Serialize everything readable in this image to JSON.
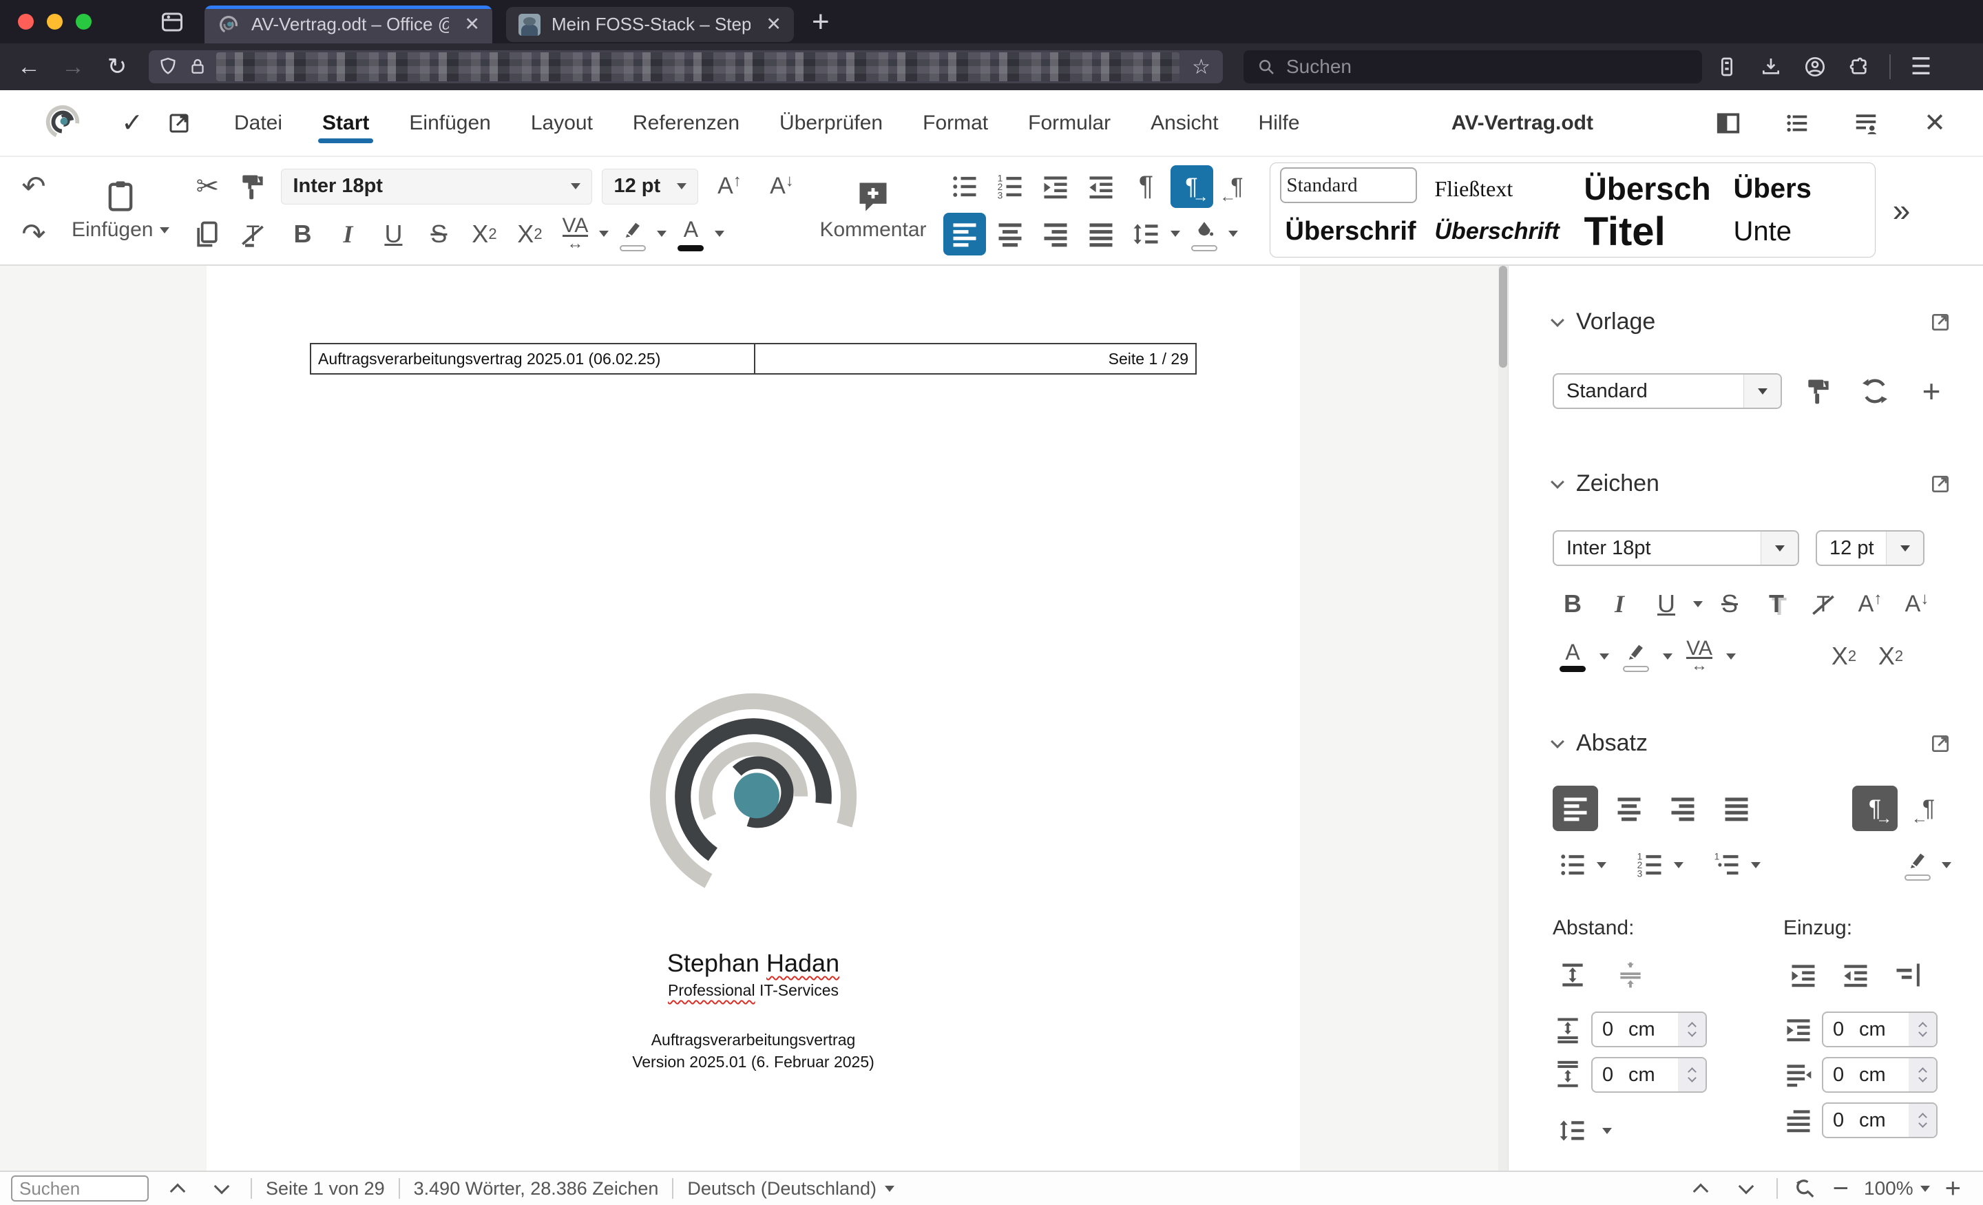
{
  "browser": {
    "tabs": [
      {
        "title": "AV-Vertrag.odt – Office @ Hada",
        "active": true
      },
      {
        "title": "Mein FOSS-Stack – Stephan Ha",
        "active": false
      }
    ],
    "search_placeholder": "Suchen"
  },
  "app": {
    "menu": [
      "Datei",
      "Start",
      "Einfügen",
      "Layout",
      "Referenzen",
      "Überprüfen",
      "Format",
      "Formular",
      "Ansicht",
      "Hilfe"
    ],
    "active_menu": "Start",
    "doc_title": "AV-Vertrag.odt"
  },
  "toolbar": {
    "paste_label": "Einfügen",
    "comment_label": "Kommentar",
    "font_name": "Inter 18pt",
    "font_size": "12 pt",
    "styles": [
      "Standard",
      "Fließtext",
      "Übersch",
      "Übers",
      "Überschrif",
      "Überschrift",
      "Titel",
      "Unte"
    ]
  },
  "sidebar": {
    "vorlage": {
      "title": "Vorlage",
      "value": "Standard"
    },
    "zeichen": {
      "title": "Zeichen",
      "font_name": "Inter 18pt",
      "font_size": "12 pt"
    },
    "absatz": {
      "title": "Absatz"
    },
    "abstand": {
      "label": "Abstand:",
      "fields": [
        {
          "value": "0",
          "unit": "cm"
        },
        {
          "value": "0",
          "unit": "cm"
        }
      ]
    },
    "einzug": {
      "label": "Einzug:",
      "fields": [
        {
          "value": "0",
          "unit": "cm"
        },
        {
          "value": "0",
          "unit": "cm"
        },
        {
          "value": "0",
          "unit": "cm"
        }
      ]
    }
  },
  "document": {
    "header_left": "Auftragsverarbeitungsvertrag 2025.01 (06.02.25)",
    "header_right": "Seite 1 / 29",
    "name_first": "Stephan ",
    "name_last": "Hadan",
    "subtitle_word": "Professional",
    "subtitle_rest": " IT-Services",
    "line1": "Auftragsverarbeitungsvertrag",
    "line2": "Version 2025.01 (6. Februar 2025)"
  },
  "statusbar": {
    "search_placeholder": "Suchen",
    "page_info": "Seite 1 von 29",
    "stats": "3.490 Wörter, 28.386 Zeichen",
    "language": "Deutsch (Deutschland)",
    "zoom": "100%"
  },
  "glyphs": {
    "back": "←",
    "forward": "→",
    "reload": "↻",
    "star": "☆",
    "menu": "☰",
    "undo": "↶",
    "redo": "↷",
    "cut": "✂",
    "pilcrow": "¶",
    "plus": "+",
    "minus": "−",
    "close": "✕",
    "check": "✓",
    "more": "»",
    "bold": "B",
    "italic": "I",
    "underline": "U",
    "strike": "S",
    "shadow": "T",
    "clear": "T",
    "x": "X",
    "two": "2",
    "va": "VA",
    "color_a": "A",
    "arrow_up": "↑",
    "arrow_down": "↓",
    "arrow_lr": "↔",
    "arrow_r": "→",
    "arrow_l": "←"
  },
  "colors": {
    "accent_blue": "#1a73a8",
    "teal": "#4a8d99",
    "tab_stripe": "#2f7cf6"
  }
}
